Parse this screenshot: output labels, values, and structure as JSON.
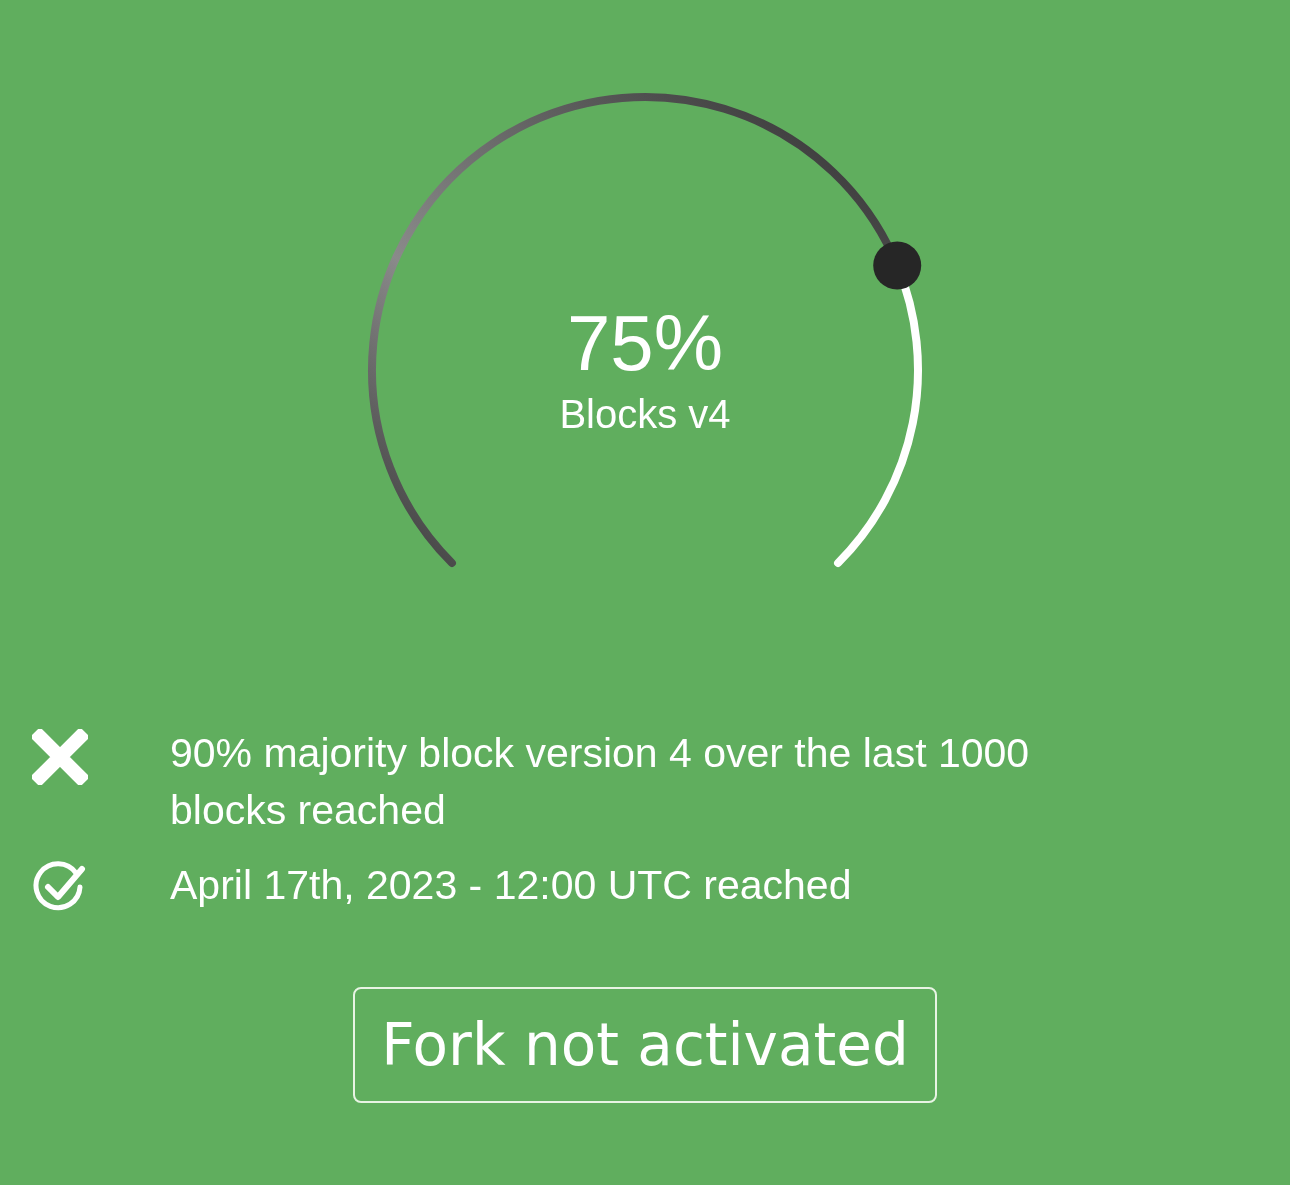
{
  "gauge": {
    "value": "75%",
    "label": "Blocks v4"
  },
  "conditions": [
    {
      "text": "90% majority block version 4 over the last 1000 blocks reached",
      "met": false
    },
    {
      "text": "April 17th, 2023 - 12:00 UTC reached",
      "met": true
    }
  ],
  "status_button": {
    "label": "Fork not activated"
  }
}
